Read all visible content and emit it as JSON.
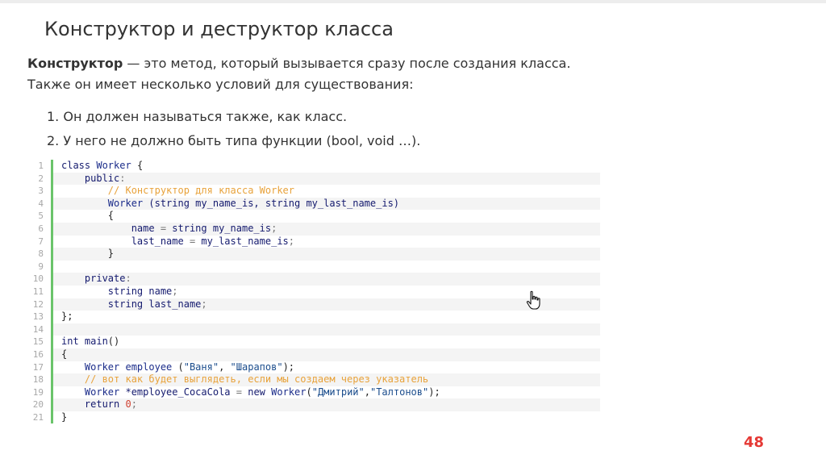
{
  "slide": {
    "title": "Конструктор и деструктор класса",
    "intro_bold": "Конструктор",
    "intro_rest": " — это метод, который вызывается сразу после создания класса. Также он имеет несколько условий для существования:",
    "list": [
      "1. Он должен называться также, как класс.",
      "2. У него не должно быть типа функции (bool, void …)."
    ],
    "page_number": "48"
  },
  "code": {
    "line_numbers": [
      "1",
      "2",
      "3",
      "4",
      "5",
      "6",
      "7",
      "8",
      "9",
      "10",
      "11",
      "12",
      "13",
      "14",
      "15",
      "16",
      "17",
      "18",
      "19",
      "20",
      "21"
    ],
    "lines": [
      [
        {
          "t": "class ",
          "c": "kw"
        },
        {
          "t": "Worker",
          "c": "ty"
        },
        {
          "t": " {",
          "c": ""
        }
      ],
      [
        {
          "t": "    public",
          "c": "kw"
        },
        {
          "t": ":",
          "c": "op"
        }
      ],
      [
        {
          "t": "        // Конструктор для класса ",
          "c": "cm"
        },
        {
          "t": "Worker",
          "c": "cm"
        }
      ],
      [
        {
          "t": "        Worker ",
          "c": "ty"
        },
        {
          "t": "(string my_name_is, string my_last_name_is)",
          "c": "kw"
        }
      ],
      [
        {
          "t": "        {",
          "c": ""
        }
      ],
      [
        {
          "t": "            name ",
          "c": "kw"
        },
        {
          "t": "= ",
          "c": "op"
        },
        {
          "t": "string my_name_is",
          "c": "kw"
        },
        {
          "t": ";",
          "c": "op"
        }
      ],
      [
        {
          "t": "            last_name ",
          "c": "kw"
        },
        {
          "t": "= ",
          "c": "op"
        },
        {
          "t": "my_last_name_is",
          "c": "kw"
        },
        {
          "t": ";",
          "c": "op"
        }
      ],
      [
        {
          "t": "        }",
          "c": ""
        }
      ],
      [
        {
          "t": "",
          "c": ""
        }
      ],
      [
        {
          "t": "    private",
          "c": "kw"
        },
        {
          "t": ":",
          "c": "op"
        }
      ],
      [
        {
          "t": "        string name",
          "c": "kw"
        },
        {
          "t": ";",
          "c": "op"
        }
      ],
      [
        {
          "t": "        string last_name",
          "c": "kw"
        },
        {
          "t": ";",
          "c": "op"
        }
      ],
      [
        {
          "t": "};",
          "c": ""
        }
      ],
      [
        {
          "t": "",
          "c": ""
        }
      ],
      [
        {
          "t": "int main",
          "c": "kw"
        },
        {
          "t": "()",
          "c": ""
        }
      ],
      [
        {
          "t": "{",
          "c": ""
        }
      ],
      [
        {
          "t": "    Worker employee ",
          "c": "ty"
        },
        {
          "t": "(",
          "c": ""
        },
        {
          "t": "\"Ваня\"",
          "c": "str"
        },
        {
          "t": ", ",
          "c": ""
        },
        {
          "t": "\"Шарапов\"",
          "c": "str"
        },
        {
          "t": ");",
          "c": ""
        }
      ],
      [
        {
          "t": "    // вот как будет выглядеть, если мы создаем через указатель",
          "c": "cm"
        }
      ],
      [
        {
          "t": "    Worker ",
          "c": "ty"
        },
        {
          "t": "*employee_CocaCola ",
          "c": "kw"
        },
        {
          "t": "= ",
          "c": "op"
        },
        {
          "t": "new ",
          "c": "kw"
        },
        {
          "t": "Worker",
          "c": "ty"
        },
        {
          "t": "(",
          "c": ""
        },
        {
          "t": "\"Дмитрий\"",
          "c": "str"
        },
        {
          "t": ",",
          "c": ""
        },
        {
          "t": "\"Талтонов\"",
          "c": "str"
        },
        {
          "t": ");",
          "c": ""
        }
      ],
      [
        {
          "t": "    return ",
          "c": "kw"
        },
        {
          "t": "0",
          "c": "num"
        },
        {
          "t": ";",
          "c": "op"
        }
      ],
      [
        {
          "t": "}",
          "c": ""
        }
      ]
    ]
  }
}
